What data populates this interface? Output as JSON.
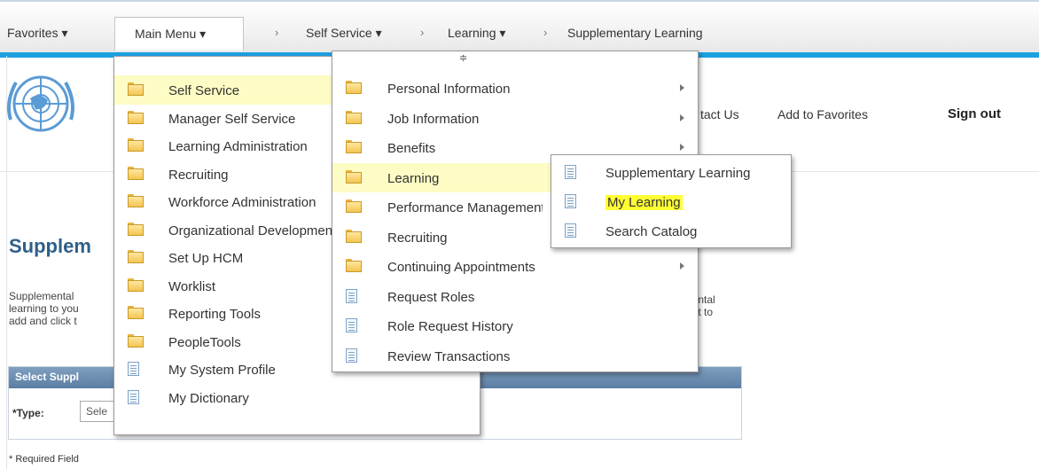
{
  "nav": {
    "favorites": "Favorites ▾",
    "main_menu": "Main Menu ▾",
    "sep": "›",
    "crumbs": [
      "Self Service ▾",
      "Learning ▾",
      "Supplementary Learning"
    ]
  },
  "header": {
    "contact": "tact Us",
    "add_favorites": "Add to Favorites",
    "sign_out": "Sign out"
  },
  "page": {
    "title": "Supplem",
    "desc_lines": [
      "Supplemental",
      "learning to you",
      "add and click t"
    ],
    "desc_right": [
      "nental",
      "ant to"
    ],
    "panel_title": "Select Suppl",
    "type_label": "*Type:",
    "type_value": "Sele",
    "required": "* Required Field"
  },
  "menu1": {
    "items": [
      {
        "label": "Self Service",
        "icon": "folder-icon"
      },
      {
        "label": "Manager Self Service",
        "icon": "folder-icon"
      },
      {
        "label": "Learning Administration",
        "icon": "folder-icon"
      },
      {
        "label": "Recruiting",
        "icon": "folder-icon"
      },
      {
        "label": "Workforce Administration",
        "icon": "folder-icon"
      },
      {
        "label": "Organizational Development",
        "icon": "folder-icon"
      },
      {
        "label": "Set Up HCM",
        "icon": "folder-icon"
      },
      {
        "label": "Worklist",
        "icon": "folder-icon"
      },
      {
        "label": "Reporting Tools",
        "icon": "folder-icon"
      },
      {
        "label": "PeopleTools",
        "icon": "folder-icon"
      },
      {
        "label": "My System Profile",
        "icon": "document-icon"
      },
      {
        "label": "My Dictionary",
        "icon": "document-icon"
      }
    ]
  },
  "menu2": {
    "scroll": "≑",
    "items": [
      {
        "label": "Personal Information",
        "icon": "folder-icon",
        "arrow": true
      },
      {
        "label": "Job Information",
        "icon": "folder-icon",
        "arrow": true
      },
      {
        "label": "Benefits",
        "icon": "folder-icon",
        "arrow": true
      },
      {
        "label": "Learning",
        "icon": "folder-icon",
        "arrow": false
      },
      {
        "label": "Performance Management",
        "icon": "folder-icon",
        "arrow": false
      },
      {
        "label": "Recruiting",
        "icon": "folder-icon",
        "arrow": false
      },
      {
        "label": "Continuing Appointments",
        "icon": "folder-icon",
        "arrow": true
      },
      {
        "label": "Request Roles",
        "icon": "document-icon",
        "arrow": false
      },
      {
        "label": "Role Request History",
        "icon": "document-icon",
        "arrow": false
      },
      {
        "label": "Review Transactions",
        "icon": "document-icon",
        "arrow": false
      }
    ]
  },
  "menu3": {
    "items": [
      {
        "label": "Supplementary Learning",
        "icon": "document-icon"
      },
      {
        "label": "My Learning",
        "icon": "document-icon"
      },
      {
        "label": "Search Catalog",
        "icon": "document-icon"
      }
    ]
  },
  "colors": {
    "accent": "#1ba1e2",
    "highlight": "#fdfcc4",
    "title": "#2e5f8a"
  }
}
